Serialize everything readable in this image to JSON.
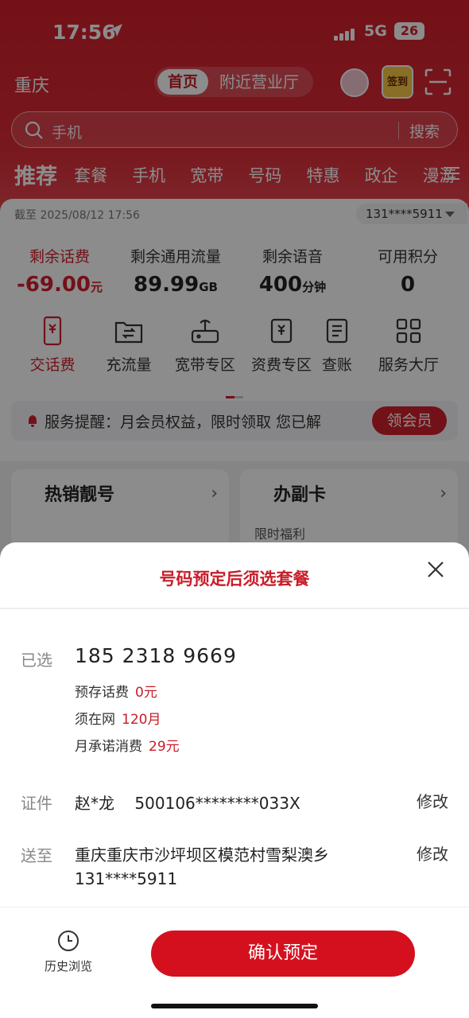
{
  "status_bar": {
    "time": "17:56",
    "network": "5G",
    "battery": "26"
  },
  "topbar": {
    "city": "重庆",
    "tabs": [
      "首页",
      "附近营业厅"
    ],
    "signin_label": "签到"
  },
  "search": {
    "placeholder": "手机",
    "button": "搜索"
  },
  "categories": {
    "first": "推荐",
    "items": [
      "套餐",
      "手机",
      "宽带",
      "号码",
      "特惠",
      "政企",
      "漫游"
    ]
  },
  "account": {
    "as_of": "截至 2025/08/12 17:56",
    "number": "131****5911",
    "stats": [
      {
        "label": "剩余话费",
        "value": "-69.00",
        "unit": "元"
      },
      {
        "label": "剩余通用流量",
        "value": "89.99",
        "unit": "GB"
      },
      {
        "label": "剩余语音",
        "value": "400",
        "unit": "分钟"
      },
      {
        "label": "可用积分",
        "value": "0",
        "unit": ""
      }
    ],
    "quick": [
      "交话费",
      "充流量",
      "宽带专区",
      "资费专区",
      "查账",
      "服务大厅"
    ]
  },
  "notice": {
    "text": "服务提醒：月会员权益，限时领取    您已解",
    "button": "领会员"
  },
  "tiles": [
    {
      "title": "热销靓号",
      "sub": ""
    },
    {
      "title": "办副卡",
      "sub": "限时福利"
    }
  ],
  "sheet": {
    "title": "号码预定后须选套餐",
    "selected_label": "已选",
    "number": "185 2318 9669",
    "details": [
      {
        "k": "预存话费",
        "v": "0元"
      },
      {
        "k": "须在网",
        "v": "120月"
      },
      {
        "k": "月承诺消费",
        "v": "29元"
      }
    ],
    "id_label": "证件",
    "id_value": "赵*龙    500106********033X",
    "edit": "修改",
    "ship_label": "送至",
    "address_line1": "重庆重庆市沙坪坝区模范村雪梨澳乡",
    "address_line2": "131****5911",
    "history": "历史浏览",
    "confirm": "确认预定"
  }
}
